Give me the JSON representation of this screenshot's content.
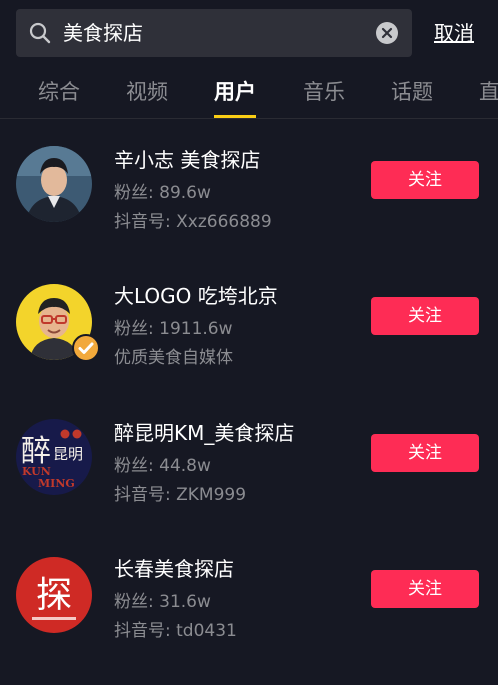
{
  "search": {
    "query": "美食探店"
  },
  "cancel_label": "取消",
  "tabs": [
    {
      "label": "综合",
      "active": false
    },
    {
      "label": "视频",
      "active": false
    },
    {
      "label": "用户",
      "active": true
    },
    {
      "label": "音乐",
      "active": false
    },
    {
      "label": "话题",
      "active": false
    },
    {
      "label": "直",
      "active": false
    }
  ],
  "colors": {
    "background": "#161823",
    "search_field": "#2f3039",
    "follow_button": "#fe2c55",
    "tab_indicator": "#face15",
    "secondary_text": "#8b8c91",
    "verified_badge": "#f2a93b"
  },
  "users": [
    {
      "name": "辛小志 美食探店",
      "followers": "粉丝: 89.6w",
      "detail": "抖音号: Xxz666889",
      "follow_label": "关注",
      "verified": false
    },
    {
      "name": "大LOGO 吃垮北京",
      "followers": "粉丝: 1911.6w",
      "detail": "优质美食自媒体",
      "follow_label": "关注",
      "verified": true
    },
    {
      "name": "醉昆明KM_美食探店",
      "followers": "粉丝: 44.8w",
      "detail": "抖音号: ZKM999",
      "follow_label": "关注",
      "verified": false,
      "avatar_text": {
        "main": "醉",
        "sub": "昆明",
        "brand1": "KUN",
        "brand2": "MING"
      }
    },
    {
      "name": "长春美食探店",
      "followers": "粉丝: 31.6w",
      "detail": "抖音号: td0431",
      "follow_label": "关注",
      "verified": false,
      "avatar_text": {
        "main": "探"
      }
    }
  ]
}
